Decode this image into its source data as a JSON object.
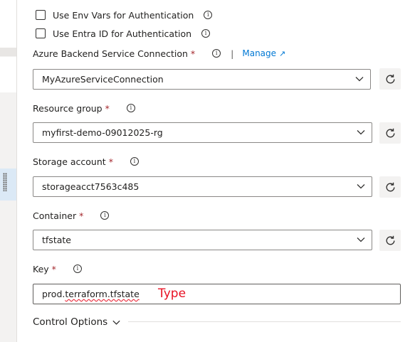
{
  "checkboxes": [
    {
      "label": "Use Env Vars for Authentication",
      "checked": false
    },
    {
      "label": "Use Entra ID for Authentication",
      "checked": false
    }
  ],
  "backend": {
    "label": "Azure Backend Service Connection",
    "required": "*",
    "separator": "|",
    "manage_link": "Manage",
    "value": "MyAzureServiceConnection"
  },
  "resource_group": {
    "label": "Resource group",
    "required": "*",
    "value": "myfirst-demo-09012025-rg"
  },
  "storage_account": {
    "label": "Storage account",
    "required": "*",
    "value": "storageacct7563c485"
  },
  "container": {
    "label": "Container",
    "required": "*",
    "value": "tfstate"
  },
  "key": {
    "label": "Key",
    "required": "*",
    "value_plain": "prod.",
    "value_underlined": "terraform.tfstate"
  },
  "annotation": {
    "text": "Type",
    "color": "#e81123"
  },
  "control_options": {
    "label": "Control Options"
  },
  "colors": {
    "accent": "#0078d4",
    "required": "#a4262c",
    "border": "#8a8886"
  }
}
